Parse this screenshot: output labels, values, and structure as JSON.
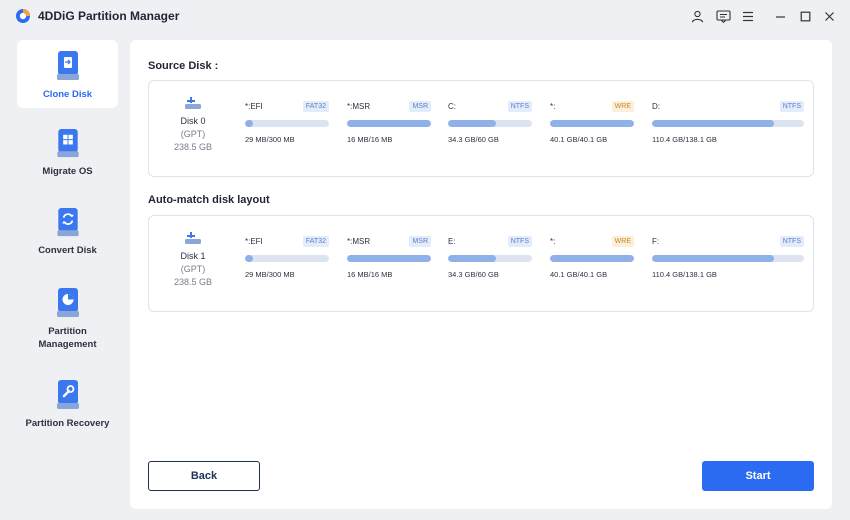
{
  "app": {
    "title": "4DDiG Partition Manager",
    "logo_icon": "4ddig-logo",
    "accent": "#2a6bf2"
  },
  "titlebar_icons": [
    "user-icon",
    "feedback-icon",
    "menu-icon",
    "minimize-icon",
    "maximize-icon",
    "close-icon"
  ],
  "sidebar": {
    "items": [
      {
        "label": "Clone Disk",
        "icon": "clone-disk-icon",
        "active": true
      },
      {
        "label": "Migrate OS",
        "icon": "migrate-os-icon",
        "active": false
      },
      {
        "label": "Convert Disk",
        "icon": "convert-disk-icon",
        "active": false
      },
      {
        "label": "Partition\nManagement",
        "icon": "partition-management-icon",
        "active": false
      },
      {
        "label": "Partition Recovery",
        "icon": "partition-recovery-icon",
        "active": false
      }
    ]
  },
  "source": {
    "title": "Source Disk :",
    "disk": {
      "name": "Disk 0",
      "type": "(GPT)",
      "size": "238.5 GB"
    },
    "partitions": [
      {
        "label": "*:EFI",
        "fs": "FAT32",
        "size": "29 MB/300 MB",
        "fill": 0.097
      },
      {
        "label": "*:MSR",
        "fs": "MSR",
        "size": "16 MB/16 MB",
        "fill": 1.0
      },
      {
        "label": "C:",
        "fs": "NTFS",
        "size": "34.3 GB/60 GB",
        "fill": 0.57
      },
      {
        "label": "*:",
        "fs": "WRE",
        "size": "40.1 GB/40.1 GB",
        "fill": 1.0
      },
      {
        "label": "D:",
        "fs": "NTFS",
        "size": "110.4 GB/138.1 GB",
        "fill": 0.8
      }
    ]
  },
  "target": {
    "title": "Auto-match disk layout",
    "disk": {
      "name": "Disk 1",
      "type": "(GPT)",
      "size": "238.5 GB"
    },
    "partitions": [
      {
        "label": "*:EFI",
        "fs": "FAT32",
        "size": "29 MB/300 MB",
        "fill": 0.097
      },
      {
        "label": "*:MSR",
        "fs": "MSR",
        "size": "16 MB/16 MB",
        "fill": 1.0
      },
      {
        "label": "E:",
        "fs": "NTFS",
        "size": "34.3 GB/60 GB",
        "fill": 0.57
      },
      {
        "label": "*:",
        "fs": "WRE",
        "size": "40.1 GB/40.1 GB",
        "fill": 1.0
      },
      {
        "label": "F:",
        "fs": "NTFS",
        "size": "110.4 GB/138.1 GB",
        "fill": 0.8
      }
    ]
  },
  "badge_colors": {
    "FAT32": {
      "bg": "#e3ecfb",
      "fg": "#5b7fc4"
    },
    "MSR": {
      "bg": "#e3ecfb",
      "fg": "#5b7fc4"
    },
    "NTFS": {
      "bg": "#e3ecfb",
      "fg": "#5b7fc4"
    },
    "WRE": {
      "bg": "#fcefd9",
      "fg": "#c58b2a"
    }
  },
  "actions": {
    "back_label": "Back",
    "start_label": "Start"
  }
}
